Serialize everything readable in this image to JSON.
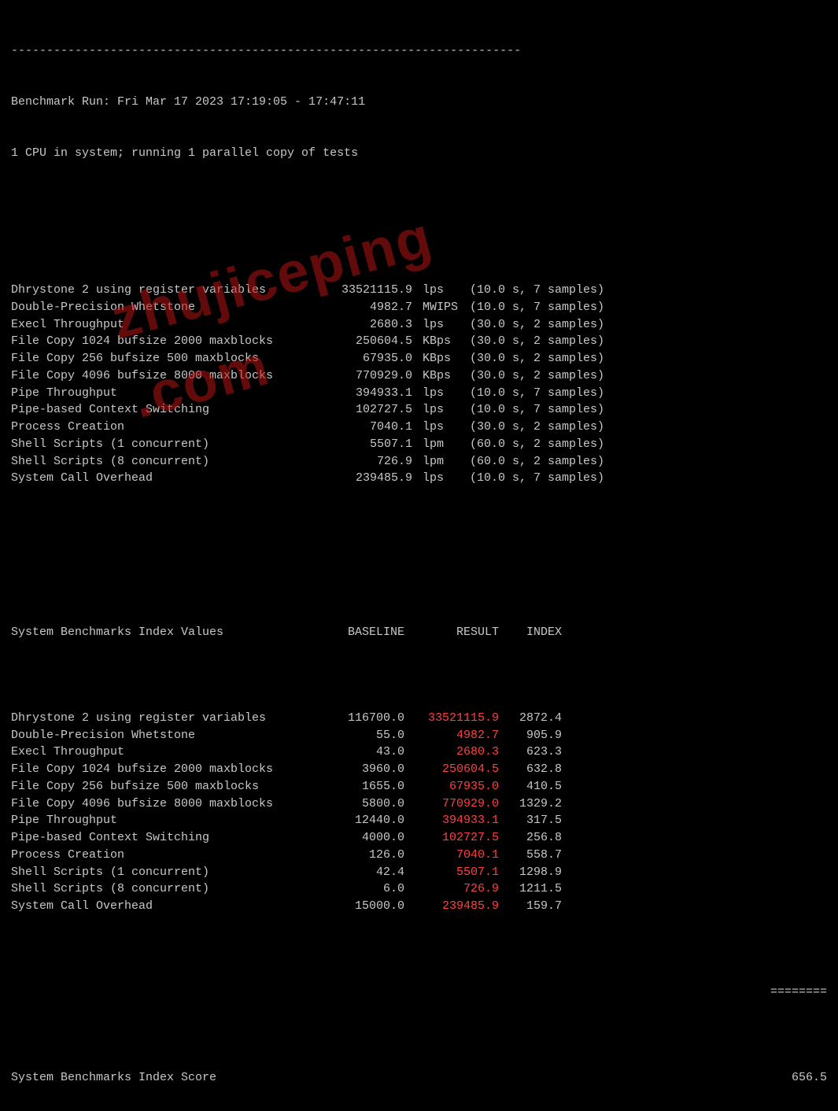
{
  "divider": "------------------------------------------------------------------------",
  "header": {
    "line1": "Benchmark Run: Fri Mar 17 2023 17:19:05 - 17:47:11",
    "line2": "1 CPU in system; running 1 parallel copy of tests"
  },
  "benchmarks": [
    {
      "name": "Dhrystone 2 using register variables",
      "value": "33521115.9",
      "unit": "lps",
      "samples": "(10.0 s, 7 samples)"
    },
    {
      "name": "Double-Precision Whetstone",
      "value": "4982.7",
      "unit": "MWIPS",
      "samples": "(10.0 s, 7 samples)"
    },
    {
      "name": "Execl Throughput",
      "value": "2680.3",
      "unit": "lps",
      "samples": "(30.0 s, 2 samples)"
    },
    {
      "name": "File Copy 1024 bufsize 2000 maxblocks",
      "value": "250604.5",
      "unit": "KBps",
      "samples": "(30.0 s, 2 samples)"
    },
    {
      "name": "File Copy 256 bufsize 500 maxblocks",
      "value": "67935.0",
      "unit": "KBps",
      "samples": "(30.0 s, 2 samples)"
    },
    {
      "name": "File Copy 4096 bufsize 8000 maxblocks",
      "value": "770929.0",
      "unit": "KBps",
      "samples": "(30.0 s, 2 samples)"
    },
    {
      "name": "Pipe Throughput",
      "value": "394933.1",
      "unit": "lps",
      "samples": "(10.0 s, 7 samples)"
    },
    {
      "name": "Pipe-based Context Switching",
      "value": "102727.5",
      "unit": "lps",
      "samples": "(10.0 s, 7 samples)"
    },
    {
      "name": "Process Creation",
      "value": "7040.1",
      "unit": "lps",
      "samples": "(30.0 s, 2 samples)"
    },
    {
      "name": "Shell Scripts (1 concurrent)",
      "value": "5507.1",
      "unit": "lpm",
      "samples": "(60.0 s, 2 samples)"
    },
    {
      "name": "Shell Scripts (8 concurrent)",
      "value": "726.9",
      "unit": "lpm",
      "samples": "(60.0 s, 2 samples)"
    },
    {
      "name": "System Call Overhead",
      "value": "239485.9",
      "unit": "lps",
      "samples": "(10.0 s, 7 samples)"
    }
  ],
  "table_header": {
    "name": "System Benchmarks Index Values",
    "baseline": "BASELINE",
    "result": "RESULT",
    "index": "INDEX"
  },
  "table_rows": [
    {
      "name": "Dhrystone 2 using register variables",
      "baseline": "116700.0",
      "result": "33521115.9",
      "index": "2872.4"
    },
    {
      "name": "Double-Precision Whetstone",
      "baseline": "55.0",
      "result": "4982.7",
      "index": "905.9"
    },
    {
      "name": "Execl Throughput",
      "baseline": "43.0",
      "result": "2680.3",
      "index": "623.3"
    },
    {
      "name": "File Copy 1024 bufsize 2000 maxblocks",
      "baseline": "3960.0",
      "result": "250604.5",
      "index": "632.8"
    },
    {
      "name": "File Copy 256 bufsize 500 maxblocks",
      "baseline": "1655.0",
      "result": "67935.0",
      "index": "410.5"
    },
    {
      "name": "File Copy 4096 bufsize 8000 maxblocks",
      "baseline": "5800.0",
      "result": "770929.0",
      "index": "1329.2"
    },
    {
      "name": "Pipe Throughput",
      "baseline": "12440.0",
      "result": "394933.1",
      "index": "317.5"
    },
    {
      "name": "Pipe-based Context Switching",
      "baseline": "4000.0",
      "result": "102727.5",
      "index": "256.8"
    },
    {
      "name": "Process Creation",
      "baseline": "126.0",
      "result": "7040.1",
      "index": "558.7"
    },
    {
      "name": "Shell Scripts (1 concurrent)",
      "baseline": "42.4",
      "result": "5507.1",
      "index": "1298.9"
    },
    {
      "name": "Shell Scripts (8 concurrent)",
      "baseline": "6.0",
      "result": "726.9",
      "index": "1211.5"
    },
    {
      "name": "System Call Overhead",
      "baseline": "15000.0",
      "result": "239485.9",
      "index": "159.7"
    }
  ],
  "equals": "========",
  "score": {
    "label": "System Benchmarks Index Score",
    "value": "656.5"
  },
  "watermark": {
    "line1": "zhujiceping",
    "line2": ".com"
  }
}
